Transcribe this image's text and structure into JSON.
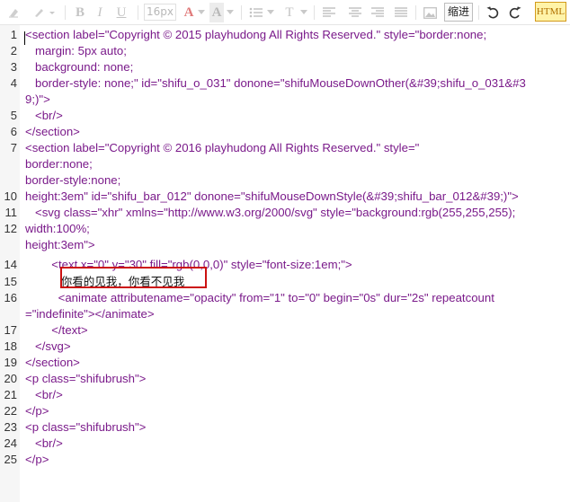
{
  "toolbar": {
    "font_size": "16px",
    "indent_label": "缩进",
    "html_label": "HTML",
    "icons": [
      "eraser-icon",
      "brush-icon",
      "bold-icon",
      "italic-icon",
      "underline-icon",
      "font-color-icon",
      "background-color-icon",
      "list-icon",
      "paragraph-icon",
      "align-left-icon",
      "align-center-icon",
      "align-right-icon",
      "align-justify-icon",
      "image-icon",
      "undo-icon",
      "redo-icon"
    ],
    "letters": {
      "bold": "B",
      "italic": "I",
      "underline": "U",
      "font_color": "A",
      "bg_color": "A",
      "paragraph": "T"
    }
  },
  "editor": {
    "lines": [
      {
        "n": "1",
        "text": "<section label=\"Copyright © 2015 playhudong All Rights Reserved.\" style=\"border:none;"
      },
      {
        "n": "2",
        "text": "   margin: 5px auto;"
      },
      {
        "n": "3",
        "text": "   background: none;"
      },
      {
        "n": "4",
        "text": "   border-style: none;\" id=\"shifu_o_031\" donone=\"shifuMouseDownOther(&#39;shifu_o_031&#3"
      },
      {
        "n": "",
        "text": "9;)\">"
      },
      {
        "n": "5",
        "text": "   <br/>"
      },
      {
        "n": "6",
        "text": "</section>"
      },
      {
        "n": "7",
        "text": "<section label=\"Copyright © 2016 playhudong All Rights Reserved.\" style=\""
      },
      {
        "n": "",
        "text": "border:none;"
      },
      {
        "n": "",
        "text": "border-style:none;"
      },
      {
        "n": "10",
        "text": "height:3em\" id=\"shifu_bar_012\" donone=\"shifuMouseDownStyle(&#39;shifu_bar_012&#39;)\">"
      },
      {
        "n": "11",
        "text": "   <svg class=\"xhr\" xmlns=\"http://www.w3.org/2000/svg\" style=\"background:rgb(255,255,255);"
      },
      {
        "n": "12",
        "text": "width:100%;"
      },
      {
        "n": "",
        "text": "height:3em\">"
      },
      {
        "n": "14",
        "text": "        <text x=\"0\" y=\"30\" fill=\"rgb(0,0,0)\" style=\"font-size:1em;\">"
      },
      {
        "n": "15",
        "text": "          你看的见我，你看不见我"
      },
      {
        "n": "16",
        "text": "          <animate attributename=\"opacity\" from=\"1\" to=\"0\" begin=\"0s\" dur=\"2s\" repeatcount"
      },
      {
        "n": "",
        "text": "=\"indefinite\"></animate>"
      },
      {
        "n": "17",
        "text": "        </text>"
      },
      {
        "n": "18",
        "text": "   </svg>"
      },
      {
        "n": "19",
        "text": "</section>"
      },
      {
        "n": "20",
        "text": "<p class=\"shifubrush\">"
      },
      {
        "n": "21",
        "text": "   <br/>"
      },
      {
        "n": "22",
        "text": "</p>"
      },
      {
        "n": "23",
        "text": "<p class=\"shifubrush\">"
      },
      {
        "n": "24",
        "text": "   <br/>"
      },
      {
        "n": "25",
        "text": "</p>"
      }
    ]
  },
  "colors": {
    "code_text": "#7a1a8a",
    "highlight_border": "#cc1111",
    "html_button_bg": "#fff3a8"
  }
}
